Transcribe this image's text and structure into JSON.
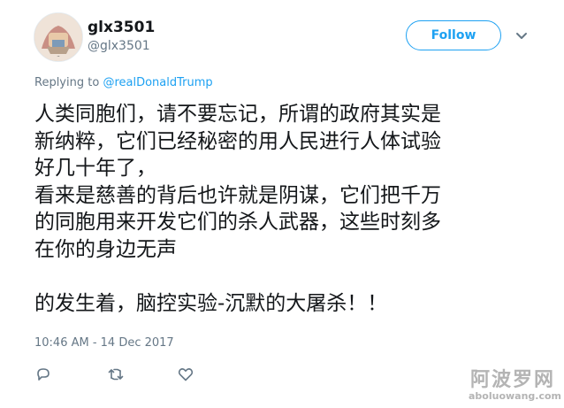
{
  "user": {
    "display_name": "glx3501",
    "handle": "@glx3501"
  },
  "follow_label": "Follow",
  "reply_context": {
    "prefix": "Replying to",
    "mention": "@realDonaldTrump"
  },
  "tweet": {
    "lines": [
      "人类同胞们，请不要忘记，所谓的政府其实是",
      "新纳粹，它们已经秘密的用人民进行人体试验",
      "好几十年了，",
      "看来是慈善的背后也许就是阴谋，它们把千万",
      "的同胞用来开发它们的杀人武器，这些时刻多",
      "在你的身边无声",
      "",
      "的发生着，脑控实验-沉默的大屠杀！！"
    ],
    "timestamp": "10:46 AM - 14 Dec 2017"
  },
  "icons": {
    "reply": "reply-icon",
    "retweet": "retweet-icon",
    "like": "heart-icon",
    "more": "chevron-down-icon"
  },
  "watermark": {
    "chinese": "阿波罗网",
    "url": "aboluowang.com"
  },
  "colors": {
    "accent": "#1da1f2",
    "secondary_text": "#657786",
    "primary_text": "#14171a"
  }
}
